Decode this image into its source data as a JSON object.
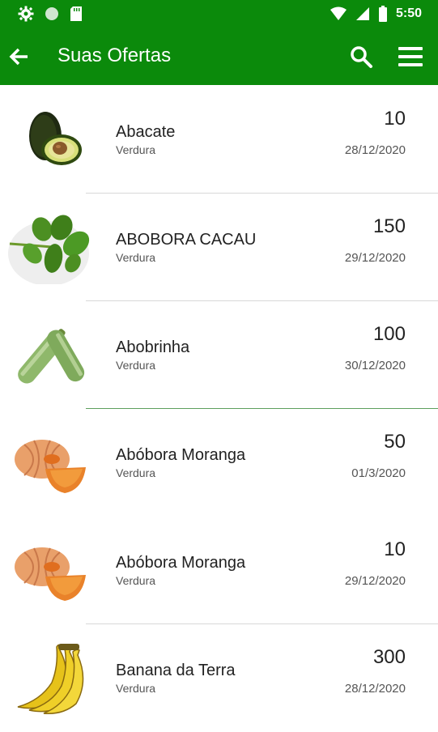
{
  "status_bar": {
    "time": "5:50"
  },
  "app_bar": {
    "title": "Suas Ofertas"
  },
  "offers": [
    {
      "name": "Abacate",
      "category": "Verdura",
      "quantity": "10",
      "date": "28/12/2020",
      "image": "avocado"
    },
    {
      "name": "ABOBORA CACAU",
      "category": "Verdura",
      "quantity": "150",
      "date": "29/12/2020",
      "image": "basil-leaves"
    },
    {
      "name": "Abobrinha",
      "category": "Verdura",
      "quantity": "100",
      "date": "30/12/2020",
      "image": "zucchini"
    },
    {
      "name": "Abóbora Moranga",
      "category": "Verdura",
      "quantity": "50",
      "date": "01/3/2020",
      "image": "pumpkin"
    },
    {
      "name": "Abóbora Moranga",
      "category": "Verdura",
      "quantity": "10",
      "date": "29/12/2020",
      "image": "pumpkin"
    },
    {
      "name": "Banana da Terra",
      "category": "Verdura",
      "quantity": "300",
      "date": "28/12/2020",
      "image": "banana"
    }
  ],
  "colors": {
    "primary": "#0b8a0b",
    "divider": "#d8d8d8",
    "divider_accent": "#5da05d"
  }
}
